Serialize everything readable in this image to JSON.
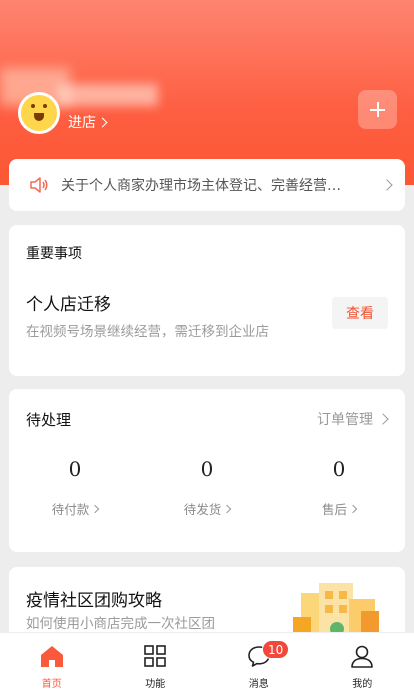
{
  "header": {
    "enter_store": "进店",
    "add_icon": "plus-icon"
  },
  "notice": {
    "icon": "speaker-icon",
    "text": "关于个人商家办理市场主体登记、完善经营…"
  },
  "important": {
    "title": "重要事项",
    "main": "个人店迁移",
    "sub": "在视频号场景继续经营，需迁移到企业店",
    "button": "查看"
  },
  "pending": {
    "title": "待处理",
    "link": "订单管理",
    "stats": [
      {
        "value": "0",
        "label": "待付款"
      },
      {
        "value": "0",
        "label": "待发货"
      },
      {
        "value": "0",
        "label": "售后"
      }
    ]
  },
  "promo": {
    "title": "疫情社区团购攻略",
    "sub": "如何使用小商店完成一次社区团"
  },
  "tabbar": {
    "items": [
      {
        "label": "首页",
        "icon": "home-icon"
      },
      {
        "label": "功能",
        "icon": "grid-icon"
      },
      {
        "label": "消息",
        "icon": "message-icon"
      },
      {
        "label": "我的",
        "icon": "user-icon"
      }
    ],
    "badge": "10"
  },
  "colors": {
    "brand": "#fa5a3b",
    "hero_top": "#fe8470",
    "hero_bottom": "#fb5734",
    "background": "#ededed"
  }
}
